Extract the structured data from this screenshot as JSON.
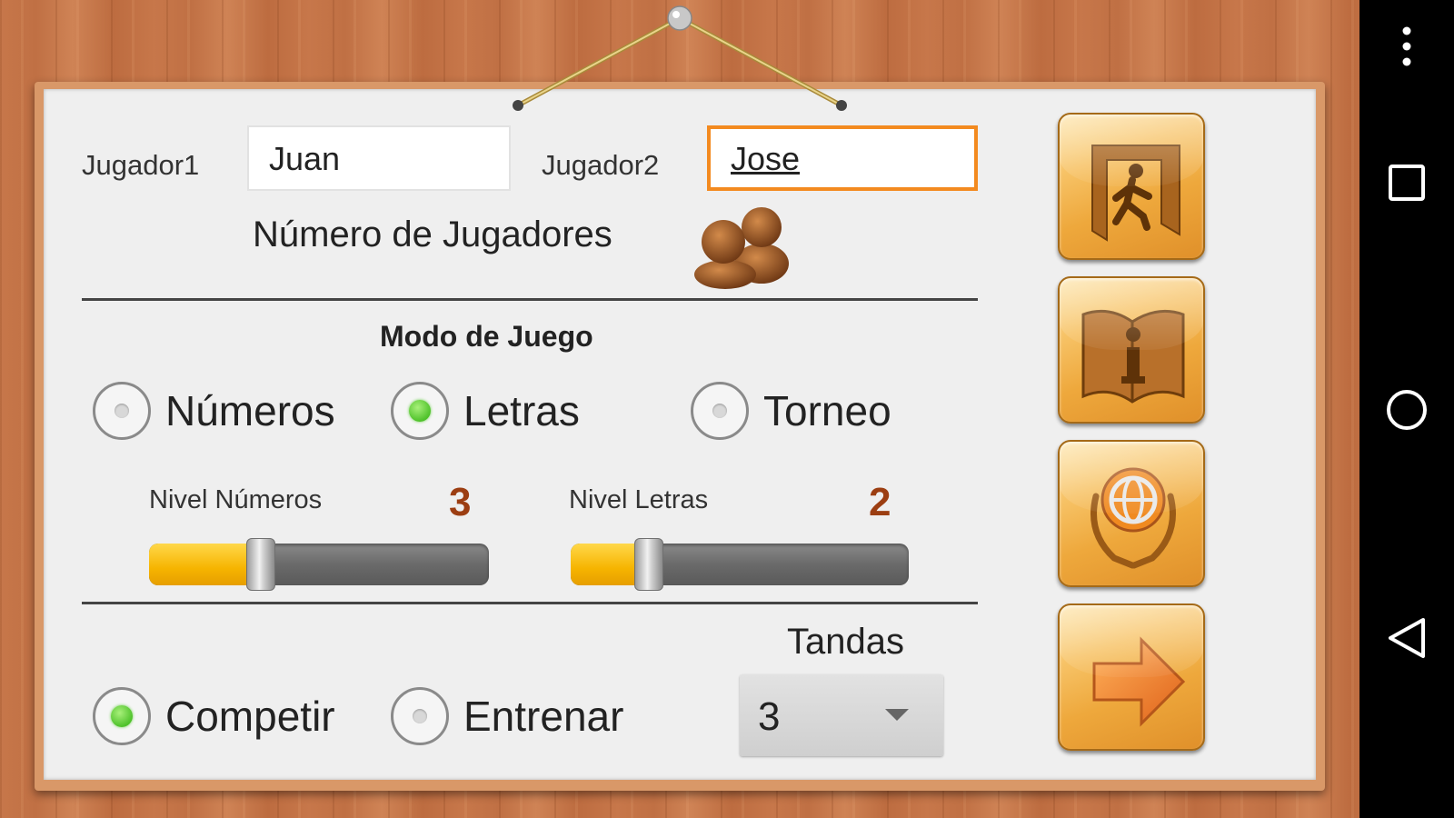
{
  "players": {
    "player1_label": "Jugador1",
    "player1_value": "Juan",
    "player2_label": "Jugador2",
    "player2_value": "Jose",
    "count_heading": "Número de Jugadores"
  },
  "mode": {
    "heading": "Modo de Juego",
    "options": [
      {
        "label": "Números",
        "checked": false
      },
      {
        "label": "Letras",
        "checked": true
      },
      {
        "label": "Torneo",
        "checked": false
      }
    ]
  },
  "levels": {
    "numbers_label": "Nivel Números",
    "numbers_value": "3",
    "numbers_fraction": 0.33,
    "letters_label": "Nivel Letras",
    "letters_value": "2",
    "letters_fraction": 0.23
  },
  "play": {
    "options": [
      {
        "label": "Competir",
        "checked": true
      },
      {
        "label": "Entrenar",
        "checked": false
      }
    ],
    "rounds_label": "Tandas",
    "rounds_value": "3"
  },
  "side_buttons": [
    "exit-icon",
    "info-book-icon",
    "globe-laurel-icon",
    "next-arrow-icon"
  ],
  "colors": {
    "accent_orange": "#f38a1f",
    "level_value": "#9c3e12",
    "radio_checked": "#4fc22b",
    "slider_fill": "#f6b400"
  }
}
